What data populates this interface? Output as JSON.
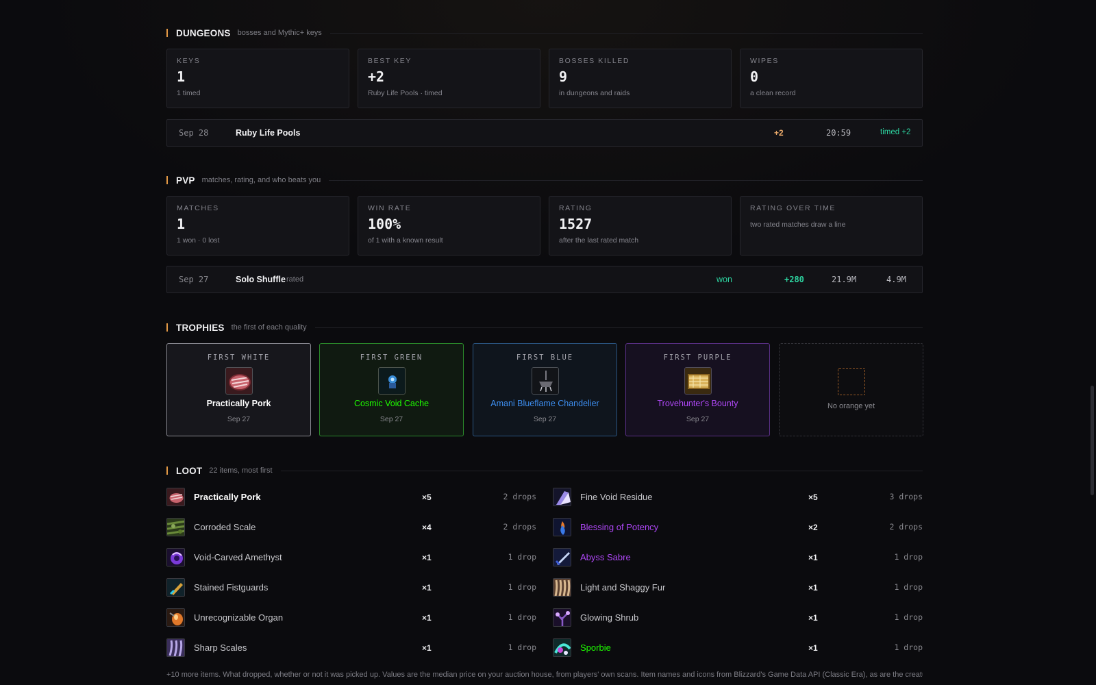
{
  "dungeons": {
    "title": "DUNGEONS",
    "subtitle": "bosses and Mythic+ keys",
    "cards": [
      {
        "label": "KEYS",
        "value": "1",
        "note": "1 timed"
      },
      {
        "label": "BEST KEY",
        "value": "+2",
        "note": "Ruby Life Pools · timed"
      },
      {
        "label": "BOSSES KILLED",
        "value": "9",
        "note": "in dungeons and raids"
      },
      {
        "label": "WIPES",
        "value": "0",
        "note": "a clean record"
      }
    ],
    "run": {
      "date": "Sep 28",
      "name": "Ruby Life Pools",
      "level": "+2",
      "time": "20:59",
      "result": "timed +2"
    }
  },
  "pvp": {
    "title": "PVP",
    "subtitle": "matches, rating, and who beats you",
    "cards": [
      {
        "label": "MATCHES",
        "value": "1",
        "note": "1 won · 0 lost"
      },
      {
        "label": "WIN RATE",
        "value": "100%",
        "note": "of 1 with a known result"
      },
      {
        "label": "RATING",
        "value": "1527",
        "note": "after the last rated match"
      },
      {
        "label": "RATING OVER TIME",
        "note": "two rated matches draw a line"
      }
    ],
    "match": {
      "date": "Sep 27",
      "name": "Solo Shuffle",
      "tag": "rated",
      "result": "won",
      "rating_change": "+280",
      "damage": "21.9M",
      "healing": "4.9M"
    }
  },
  "trophies": {
    "title": "TROPHIES",
    "subtitle": "the first of each quality",
    "items": [
      {
        "label": "FIRST WHITE",
        "name": "Practically Pork",
        "date": "Sep 27",
        "color": "#ffffff",
        "icon": "pork-icon"
      },
      {
        "label": "FIRST GREEN",
        "name": "Cosmic Void Cache",
        "date": "Sep 27",
        "color": "#1eff00",
        "icon": "cache-icon"
      },
      {
        "label": "FIRST BLUE",
        "name": "Amani Blueflame Chandelier",
        "date": "Sep 27",
        "color": "#3d8ef0",
        "icon": "chandelier-icon"
      },
      {
        "label": "FIRST PURPLE",
        "name": "Trovehunter's Bounty",
        "date": "Sep 27",
        "color": "#b048f8",
        "icon": "bounty-icon"
      }
    ],
    "empty_text": "No orange yet"
  },
  "loot": {
    "title": "LOOT",
    "subtitle": "22 items, most first",
    "left": [
      {
        "name": "Practically Pork",
        "qty": "×5",
        "drops": "2 drops",
        "color": "#ffffff",
        "icon": "pork-icon"
      },
      {
        "name": "Corroded Scale",
        "qty": "×4",
        "drops": "2 drops",
        "color": "#c8c8cc",
        "icon": "scale-icon"
      },
      {
        "name": "Void-Carved Amethyst",
        "qty": "×1",
        "drops": "1 drop",
        "color": "#c8c8cc",
        "icon": "amethyst-icon"
      },
      {
        "name": "Stained Fistguards",
        "qty": "×1",
        "drops": "1 drop",
        "color": "#c8c8cc",
        "icon": "fistguards-icon"
      },
      {
        "name": "Unrecognizable Organ",
        "qty": "×1",
        "drops": "1 drop",
        "color": "#c8c8cc",
        "icon": "organ-icon"
      },
      {
        "name": "Sharp Scales",
        "qty": "×1",
        "drops": "1 drop",
        "color": "#c8c8cc",
        "icon": "scales-icon"
      }
    ],
    "right": [
      {
        "name": "Fine Void Residue",
        "qty": "×5",
        "drops": "3 drops",
        "color": "#c8c8cc",
        "icon": "residue-icon"
      },
      {
        "name": "Blessing of Potency",
        "qty": "×2",
        "drops": "2 drops",
        "color": "#b048f8",
        "icon": "blessing-icon"
      },
      {
        "name": "Abyss Sabre",
        "qty": "×1",
        "drops": "1 drop",
        "color": "#b048f8",
        "icon": "sabre-icon"
      },
      {
        "name": "Light and Shaggy Fur",
        "qty": "×1",
        "drops": "1 drop",
        "color": "#c8c8cc",
        "icon": "fur-icon"
      },
      {
        "name": "Glowing Shrub",
        "qty": "×1",
        "drops": "1 drop",
        "color": "#c8c8cc",
        "icon": "shrub-icon"
      },
      {
        "name": "Sporbie",
        "qty": "×1",
        "drops": "1 drop",
        "color": "#1eff00",
        "icon": "sporbie-icon"
      }
    ],
    "footer": "+10 more items. What dropped, whether or not it was picked up. Values are the median price on your auction house, from players' own scans. Item names and icons from Blizzard's Game Data API (Classic Era), as are the creature"
  },
  "colors": {
    "accent": "#e59b46",
    "positive": "#2dd4a0",
    "key_orange": "#e9a96a"
  }
}
